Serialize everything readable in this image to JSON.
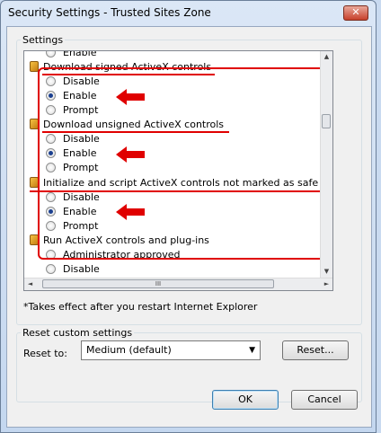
{
  "window": {
    "title": "Security Settings - Trusted Sites Zone",
    "close_glyph": "✕"
  },
  "settings_group_label": "Settings",
  "list": {
    "partial_top": "Enable",
    "groups": [
      {
        "header": "Download signed ActiveX controls",
        "options": [
          "Disable",
          "Enable",
          "Prompt"
        ],
        "selected": "Enable"
      },
      {
        "header": "Download unsigned ActiveX controls",
        "options": [
          "Disable",
          "Enable",
          "Prompt"
        ],
        "selected": "Enable"
      },
      {
        "header": "Initialize and script ActiveX controls not marked as safe for s",
        "options": [
          "Disable",
          "Enable",
          "Prompt"
        ],
        "selected": "Enable"
      },
      {
        "header": "Run ActiveX controls and plug-ins",
        "options": [
          "Administrator approved",
          "Disable"
        ],
        "selected": ""
      }
    ]
  },
  "scroll": {
    "up": "▲",
    "down": "▼",
    "left": "◄",
    "right": "►",
    "hthumb": "III"
  },
  "note": "*Takes effect after you restart Internet Explorer",
  "reset_group": {
    "legend": "Reset custom settings",
    "label": "Reset to:",
    "selected_value": "Medium (default)",
    "reset_button": "Reset..."
  },
  "buttons": {
    "ok": "OK",
    "cancel": "Cancel"
  },
  "annotation_color": "#e00000"
}
